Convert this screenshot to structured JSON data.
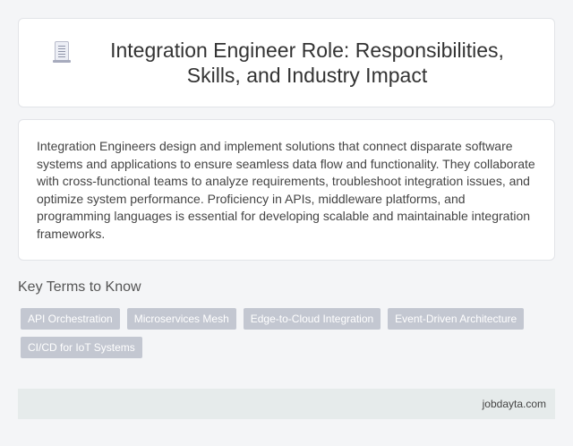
{
  "header": {
    "icon": "document-icon",
    "title": "Integration Engineer Role: Responsibilities, Skills, and Industry Impact"
  },
  "description": "Integration Engineers design and implement solutions that connect disparate software systems and applications to ensure seamless data flow and functionality. They collaborate with cross-functional teams to analyze requirements, troubleshoot integration issues, and optimize system performance. Proficiency in APIs, middleware platforms, and programming languages is essential for developing scalable and maintainable integration frameworks.",
  "key_terms": {
    "heading": "Key Terms to Know",
    "tags": [
      "API Orchestration",
      "Microservices Mesh",
      "Edge-to-Cloud Integration",
      "Event-Driven Architecture",
      "CI/CD for IoT Systems"
    ]
  },
  "footer": {
    "site": "jobdayta.com"
  }
}
